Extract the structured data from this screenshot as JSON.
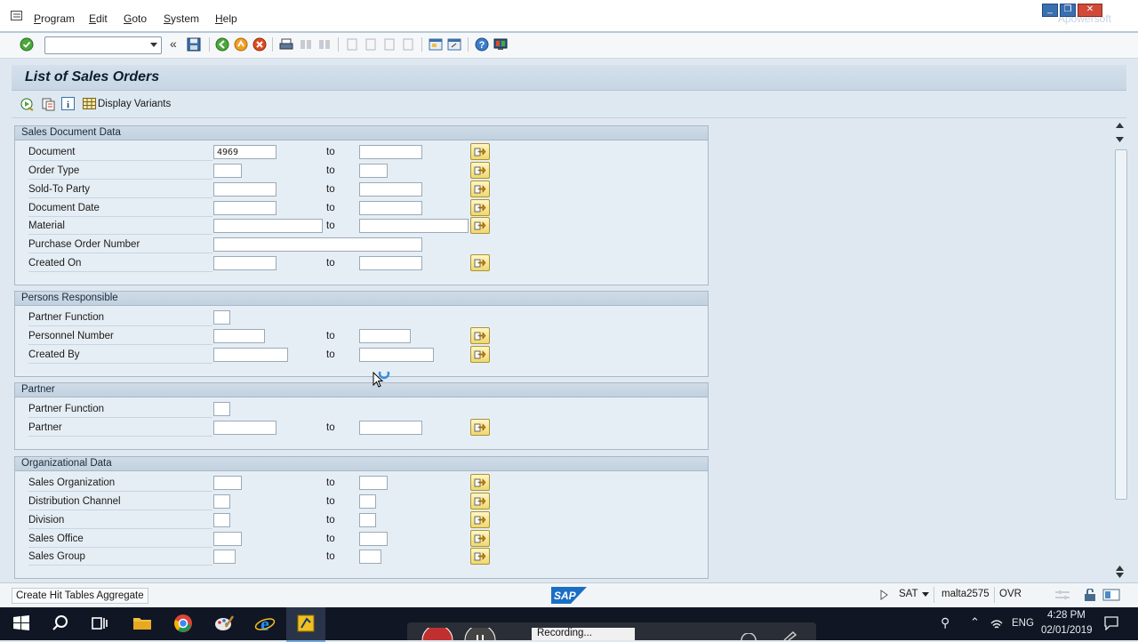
{
  "menubar": {
    "items": [
      "Program",
      "Edit",
      "Goto",
      "System",
      "Help"
    ],
    "watermark": "Apowersoft"
  },
  "toolbar": {
    "command_value": ""
  },
  "page": {
    "title": "List of Sales Orders",
    "display_variants_label": "Display Variants"
  },
  "groups": {
    "sales_document": {
      "title": "Sales Document Data",
      "rows": [
        {
          "label": "Document",
          "low": "4969",
          "to": "to"
        },
        {
          "label": "Order Type",
          "low": "",
          "to": "to"
        },
        {
          "label": "Sold-To Party",
          "low": "",
          "to": "to"
        },
        {
          "label": "Document Date",
          "low": "",
          "to": "to"
        },
        {
          "label": "Material",
          "low": "",
          "to": "to"
        },
        {
          "label": "Purchase Order Number",
          "low": ""
        },
        {
          "label": "Created On",
          "low": "",
          "to": "to"
        }
      ]
    },
    "persons": {
      "title": "Persons Responsible",
      "rows": [
        {
          "label": "Partner Function",
          "low": ""
        },
        {
          "label": "Personnel Number",
          "low": "",
          "to": "to"
        },
        {
          "label": "Created By",
          "low": "",
          "to": "to"
        }
      ]
    },
    "partner": {
      "title": "Partner",
      "rows": [
        {
          "label": "Partner Function",
          "low": ""
        },
        {
          "label": "Partner",
          "low": "",
          "to": "to"
        }
      ]
    },
    "org": {
      "title": "Organizational Data",
      "rows": [
        {
          "label": "Sales Organization",
          "to": "to"
        },
        {
          "label": "Distribution Channel",
          "to": "to"
        },
        {
          "label": "Division",
          "to": "to"
        },
        {
          "label": "Sales Office",
          "to": "to"
        },
        {
          "label": "Sales Group",
          "to": "to"
        }
      ]
    }
  },
  "statusbar": {
    "message": "Create Hit Tables Aggregate",
    "logo": "SAP",
    "system": "SAT",
    "server": "malta2575",
    "mode": "OVR"
  },
  "taskbar": {
    "recording_label": "Recording...",
    "language": "ENG",
    "time": "4:28 PM",
    "date": "02/01/2019"
  },
  "colors": {
    "header_bg": "#c8d6e4",
    "group_bg": "#e6eef5",
    "button_yellow": "#f0d870",
    "taskbar": "#101624"
  }
}
